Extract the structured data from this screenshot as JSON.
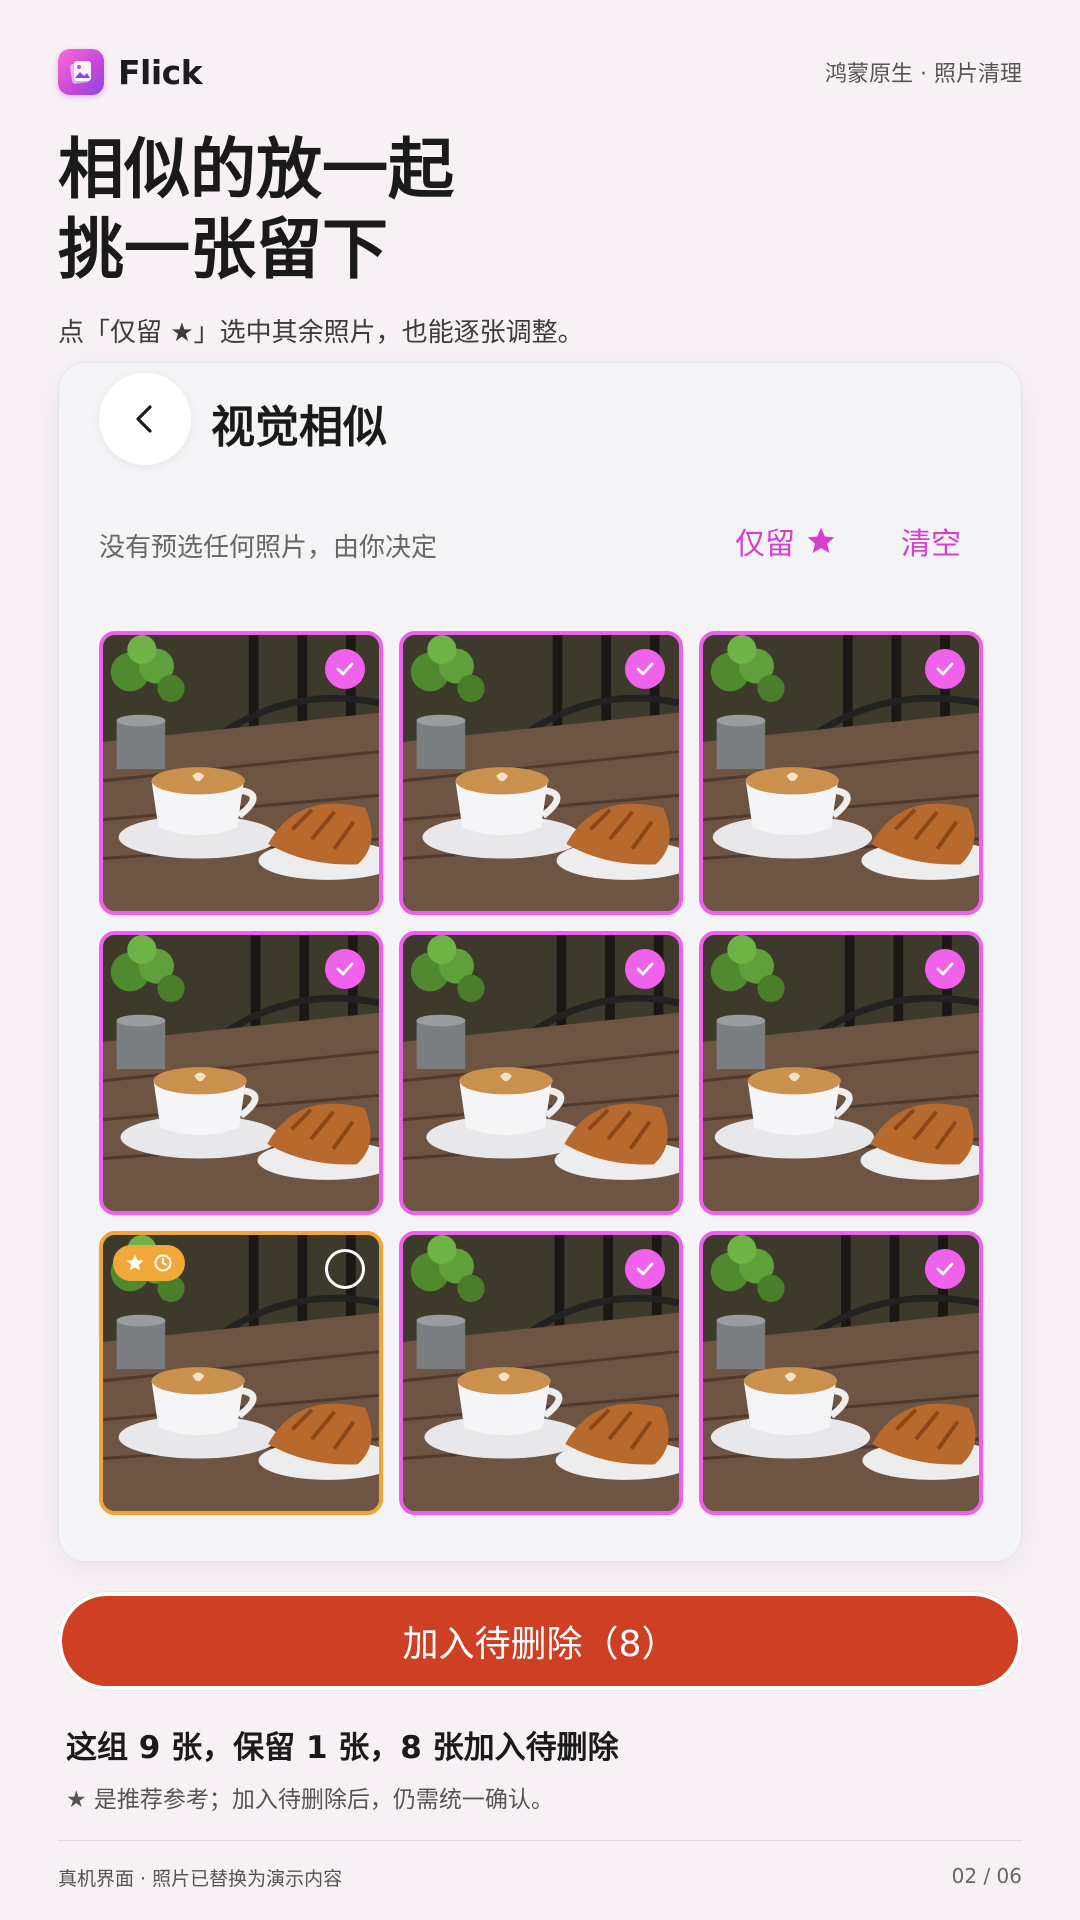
{
  "header": {
    "app_name": "Flick",
    "meta": "鸿蒙原生 · 照片清理"
  },
  "headline": {
    "line1": "相似的放一起",
    "line2": "挑一张留下"
  },
  "subline": "点「仅留 ★」选中其余照片，也能逐张调整。",
  "screen": {
    "title": "视觉相似",
    "info": "没有预选任何照片，由你决定",
    "keep_star_label": "仅留",
    "clear_label": "清空"
  },
  "photos": [
    {
      "selected": true,
      "recommended": false
    },
    {
      "selected": true,
      "recommended": false
    },
    {
      "selected": true,
      "recommended": false
    },
    {
      "selected": true,
      "recommended": false
    },
    {
      "selected": true,
      "recommended": false
    },
    {
      "selected": true,
      "recommended": false
    },
    {
      "selected": false,
      "recommended": true
    },
    {
      "selected": true,
      "recommended": false
    },
    {
      "selected": true,
      "recommended": false
    }
  ],
  "action": {
    "delete_label": "加入待删除（8）"
  },
  "summary": "这组 9 张，保留 1 张，8 张加入待删除",
  "note": "★ 是推荐参考；加入待删除后，仍需统一确认。",
  "footer": {
    "left": "真机界面 · 照片已替换为演示内容",
    "right": "02 / 06"
  },
  "colors": {
    "accent": "#d53fcf",
    "selected_border": "#ef5fee",
    "keep_border": "#f0a53a",
    "delete_button": "#cf3f24"
  },
  "icons": {
    "back": "chevron-left-icon",
    "star": "star-icon",
    "check": "check-icon",
    "clock": "clock-icon"
  }
}
